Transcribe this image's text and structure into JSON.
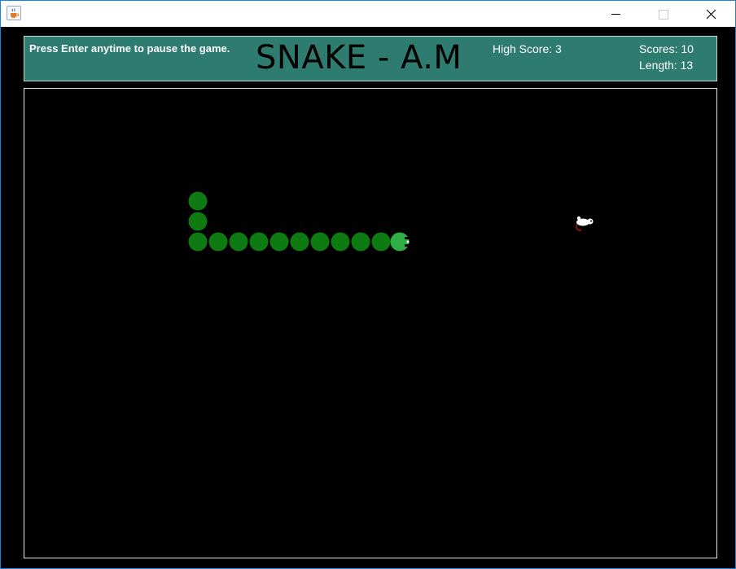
{
  "header": {
    "hint": "Press Enter anytime to pause the game.",
    "title": "SNAKE - A.M",
    "high_score_label": "High Score: 3",
    "scores_label": "Scores: 10",
    "length_label": "Length: 13"
  },
  "game": {
    "high_score": 3,
    "score": 10,
    "length": 13,
    "direction": "right",
    "snake_color": "#0e7a12",
    "head_color": "#2fae45",
    "food": "mouse"
  },
  "colors": {
    "header_bg": "#2e7b6f",
    "board_bg": "#000000",
    "title_text": "#000000"
  },
  "icons": {
    "app": "java-cup-icon",
    "minimize": "minimize-icon",
    "maximize": "maximize-icon",
    "close": "close-icon"
  }
}
